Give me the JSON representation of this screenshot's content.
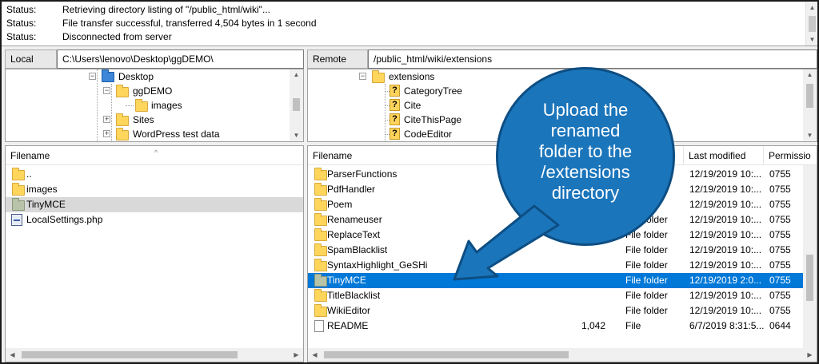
{
  "log": [
    {
      "key": "Status:",
      "msg": "Retrieving directory listing of \"/public_html/wiki\"..."
    },
    {
      "key": "Status:",
      "msg": "File transfer successful, transferred 4,504 bytes in 1 second"
    },
    {
      "key": "Status:",
      "msg": "Disconnected from server"
    }
  ],
  "local": {
    "label": "Local site:",
    "path": "C:\\Users\\lenovo\\Desktop\\ggDEMO\\",
    "tree": [
      "Desktop",
      "ggDEMO",
      "images",
      "Sites",
      "WordPress test data"
    ],
    "header": {
      "filename": "Filename"
    },
    "files": [
      "..",
      "images",
      "TinyMCE",
      "LocalSettings.php"
    ]
  },
  "remote": {
    "label": "Remote site:",
    "path": "/public_html/wiki/extensions",
    "tree": [
      "extensions",
      "CategoryTree",
      "Cite",
      "CiteThisPage",
      "CodeEditor"
    ],
    "tree_unknown_glyph": "?",
    "header": {
      "filename": "Filename",
      "type": "",
      "modified": "Last modified",
      "perms": "Permissio"
    },
    "files": [
      {
        "name": "ParserFunctions",
        "size": "",
        "type": "folder",
        "modified": "12/19/2019 10:...",
        "perms": "0755"
      },
      {
        "name": "PdfHandler",
        "size": "",
        "type": "folder",
        "modified": "12/19/2019 10:...",
        "perms": "0755"
      },
      {
        "name": "Poem",
        "size": "",
        "type": "folder",
        "modified": "12/19/2019 10:...",
        "perms": "0755"
      },
      {
        "name": "Renameuser",
        "size": "",
        "type": "File folder",
        "modified": "12/19/2019 10:...",
        "perms": "0755"
      },
      {
        "name": "ReplaceText",
        "size": "",
        "type": "File folder",
        "modified": "12/19/2019 10:...",
        "perms": "0755"
      },
      {
        "name": "SpamBlacklist",
        "size": "",
        "type": "File folder",
        "modified": "12/19/2019 10:...",
        "perms": "0755"
      },
      {
        "name": "SyntaxHighlight_GeSHi",
        "size": "",
        "type": "File folder",
        "modified": "12/19/2019 10:...",
        "perms": "0755"
      },
      {
        "name": "TinyMCE",
        "size": "",
        "type": "File folder",
        "modified": "12/19/2019 2:0...",
        "perms": "0755"
      },
      {
        "name": "TitleBlacklist",
        "size": "",
        "type": "File folder",
        "modified": "12/19/2019 10:...",
        "perms": "0755"
      },
      {
        "name": "WikiEditor",
        "size": "",
        "type": "File folder",
        "modified": "12/19/2019 10:...",
        "perms": "0755"
      },
      {
        "name": "README",
        "size": "1,042",
        "type": "File",
        "modified": "6/7/2019 8:31:5...",
        "perms": "0644"
      }
    ]
  },
  "callout": {
    "lines": [
      "Upload the",
      "renamed",
      "folder to the",
      "/extensions",
      "directory"
    ],
    "color": "#1b75bb"
  },
  "colors": {
    "selection": "#0078d7",
    "folder": "#ffd65c"
  }
}
